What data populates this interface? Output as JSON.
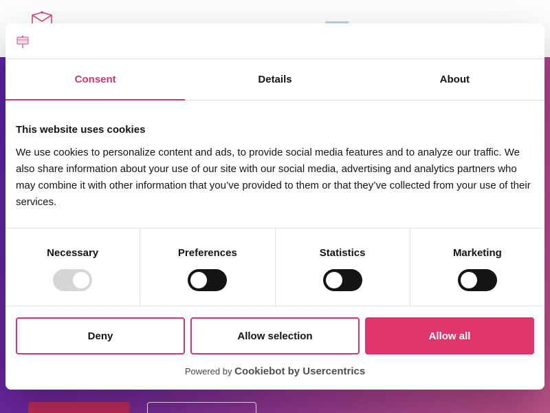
{
  "colors": {
    "accent": "#d6336c",
    "accent_fill": "#e0356b",
    "text": "#141414"
  },
  "dialog": {
    "logo_icon": "cookiebot-logo-icon",
    "tabs": [
      {
        "label": "Consent",
        "active": true
      },
      {
        "label": "Details",
        "active": false
      },
      {
        "label": "About",
        "active": false
      }
    ],
    "heading": "This website uses cookies",
    "description": "We use cookies to personalize content and ads, to provide social media features and to analyze our traffic. We also share information about your use of our site with our social media, advertising and analytics partners who may combine it with other information that you’ve provided to them or that they’ve collected from your use of their services.",
    "categories": [
      {
        "label": "Necessary",
        "checked": true,
        "disabled": true
      },
      {
        "label": "Preferences",
        "checked": false,
        "disabled": false
      },
      {
        "label": "Statistics",
        "checked": false,
        "disabled": false
      },
      {
        "label": "Marketing",
        "checked": false,
        "disabled": false
      }
    ],
    "buttons": {
      "deny": "Deny",
      "allow_selection": "Allow selection",
      "allow_all": "Allow all"
    },
    "powered_by": {
      "lead": "Powered by",
      "brand": "Cookiebot by Usercentrics"
    }
  }
}
